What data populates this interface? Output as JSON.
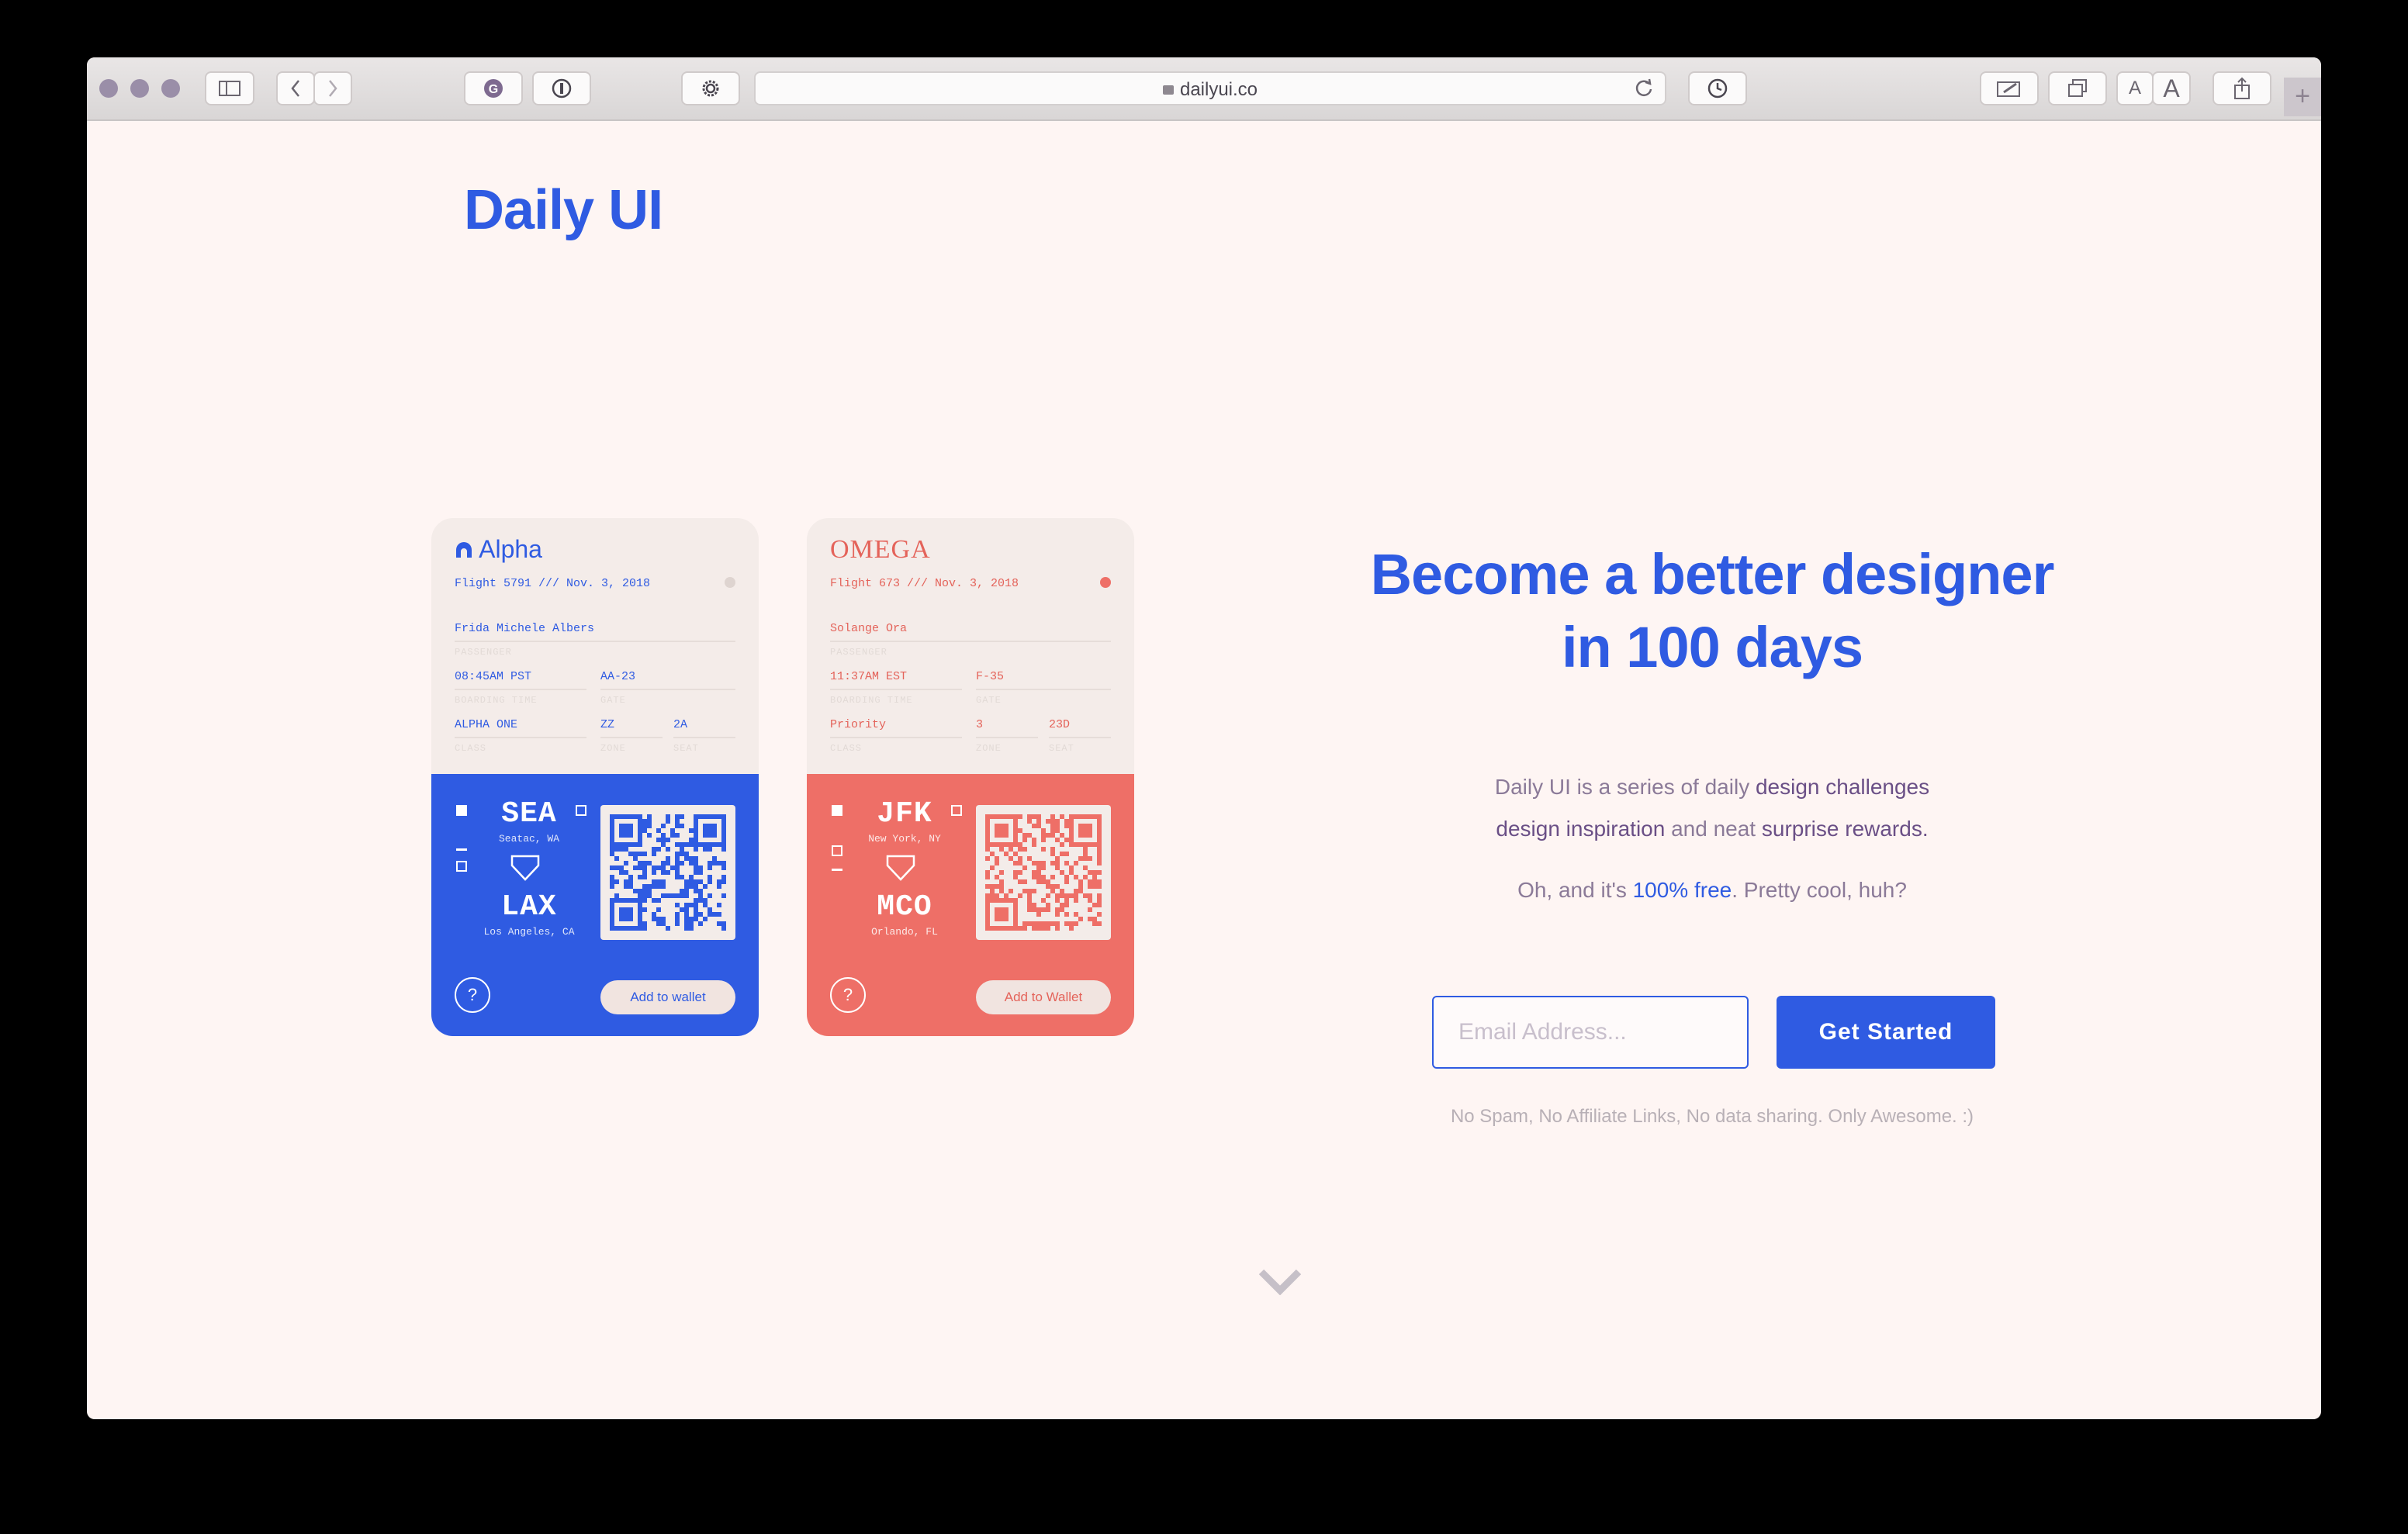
{
  "browser": {
    "url": "dailyui.co",
    "new_tab_icon": "plus",
    "reader_small": "A",
    "reader_large": "A"
  },
  "site": {
    "logo": "Daily UI"
  },
  "tickets": [
    {
      "brand": "Alpha",
      "flight": "Flight 5791 /// Nov. 3, 2018",
      "passenger": "Frida Michele Albers",
      "passenger_label": "PASSENGER",
      "boarding_time": "08:45AM PST",
      "boarding_label": "BOARDING TIME",
      "gate": "AA-23",
      "gate_label": "GATE",
      "class": "ALPHA ONE",
      "class_label": "CLASS",
      "zone": "ZZ",
      "zone_label": "ZONE",
      "seat": "2A",
      "seat_label": "SEAT",
      "from_code": "SEA",
      "from_city": "Seatac, WA",
      "to_code": "LAX",
      "to_city": "Los Angeles, CA",
      "help": "?",
      "wallet": "Add to wallet",
      "accent": "#2f5be2",
      "text": "#2f5be2"
    },
    {
      "brand": "OMEGA",
      "flight": "Flight 673 /// Nov. 3, 2018",
      "passenger": "Solange Ora",
      "passenger_label": "PASSENGER",
      "boarding_time": "11:37AM EST",
      "boarding_label": "BOARDING TIME",
      "gate": "F-35",
      "gate_label": "GATE",
      "class": "Priority",
      "class_label": "CLASS",
      "zone": "3",
      "zone_label": "ZONE",
      "seat": "23D",
      "seat_label": "SEAT",
      "from_code": "JFK",
      "from_city": "New York, NY",
      "to_code": "MCO",
      "to_city": "Orlando, FL",
      "help": "?",
      "wallet": "Add to Wallet",
      "accent": "#ee6f67",
      "text": "#e4635a"
    }
  ],
  "hero": {
    "line1": "Become a better designer",
    "line2": "in 100 days",
    "desc_1": "Daily UI is a series of daily ",
    "desc_challenges": "design challenges",
    "desc_inspiration": "design inspiration",
    "desc_2": " and neat ",
    "desc_rewards": "surprise rewards.",
    "free_1": "Oh, and it's ",
    "free_link": "100% free",
    "free_2": ". Pretty cool, huh?"
  },
  "signup": {
    "email_placeholder": "Email Address...",
    "button": "Get Started",
    "note": "No Spam, No Affiliate Links, No data sharing. Only Awesome. :)"
  },
  "colors": {
    "brand_blue": "#2f5be2",
    "coral": "#ee6f67",
    "background": "#fef5f3"
  }
}
